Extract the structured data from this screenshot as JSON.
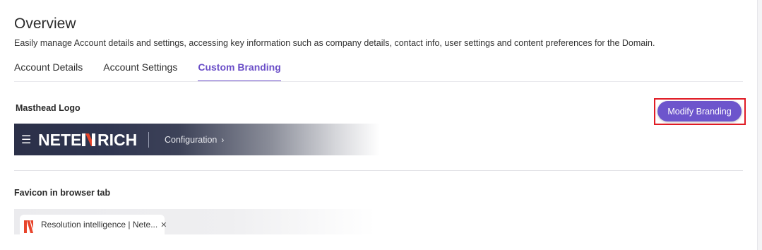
{
  "header": {
    "title": "Overview",
    "description": "Easily manage Account details and settings, accessing key information such as company details, contact info, user settings and content preferences for the Domain."
  },
  "tabs": [
    {
      "label": "Account Details",
      "active": false
    },
    {
      "label": "Account Settings",
      "active": false
    },
    {
      "label": "Custom Branding",
      "active": true
    }
  ],
  "masthead": {
    "section_label": "Masthead Logo",
    "logo_text": "NETENRICH",
    "menu_icon": "hamburger-icon",
    "nav_label": "Configuration",
    "nav_icon": "chevron-right-icon"
  },
  "actions": {
    "modify_label": "Modify Branding"
  },
  "favicon": {
    "section_label": "Favicon in browser tab",
    "tab_title": "Resolution intelligence | Nete...",
    "close_icon": "close-icon"
  },
  "colors": {
    "accent": "#6b4fc8",
    "button": "#6d55cc",
    "highlight": "#e01b24",
    "logo_accent": "#e8452c",
    "masthead_dark": "#2b3048"
  }
}
